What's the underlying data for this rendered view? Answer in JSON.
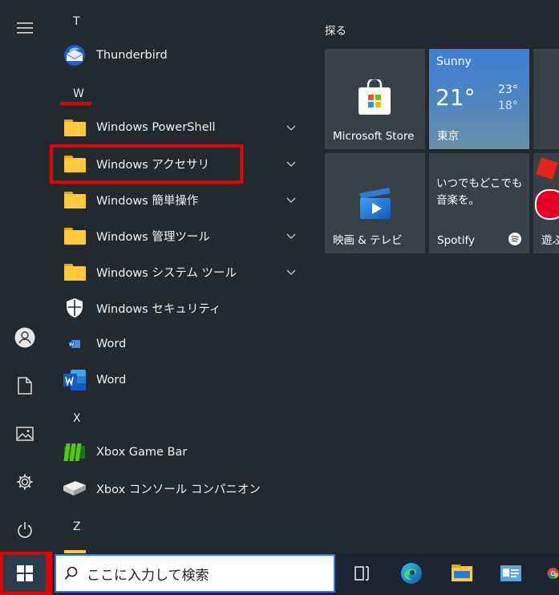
{
  "tiles_group_title": "探る",
  "app_list": {
    "letters": [
      "T",
      "W",
      "X",
      "Z"
    ],
    "items": [
      {
        "label": "Thunderbird",
        "icon": "thunderbird-icon"
      },
      {
        "label": "Windows PowerShell",
        "icon": "folder-icon",
        "expandable": true
      },
      {
        "label": "Windows アクセサリ",
        "icon": "folder-icon",
        "expandable": true,
        "highlighted": true
      },
      {
        "label": "Windows 簡単操作",
        "icon": "folder-icon",
        "expandable": true
      },
      {
        "label": "Windows 管理ツール",
        "icon": "folder-icon",
        "expandable": true
      },
      {
        "label": "Windows システム ツール",
        "icon": "folder-icon",
        "expandable": true
      },
      {
        "label": "Windows セキュリティ",
        "icon": "shield-icon"
      },
      {
        "label": "Word",
        "icon": "word-small-icon"
      },
      {
        "label": "Word",
        "icon": "word-icon"
      },
      {
        "label": "Xbox Game Bar",
        "icon": "xbox-game-bar-icon"
      },
      {
        "label": "Xbox コンソール コンパニオン",
        "icon": "xbox-console-icon"
      }
    ]
  },
  "tiles": {
    "store": {
      "label": "Microsoft Store"
    },
    "weather": {
      "condition": "Sunny",
      "temp": "21°",
      "high": "23°",
      "low": "18°",
      "city": "東京"
    },
    "movies": {
      "label": "映画 & テレビ"
    },
    "spotify": {
      "promo": "いつでもどこでも\n音楽を。",
      "label": "Spotify"
    },
    "partial": {
      "label": "遊ぶ"
    }
  },
  "taskbar": {
    "search_placeholder": "ここに入力して検索"
  },
  "colors": {
    "highlight": "#e80000",
    "weather_tile": "#3a7bd5",
    "folder": "#ffc83d"
  }
}
